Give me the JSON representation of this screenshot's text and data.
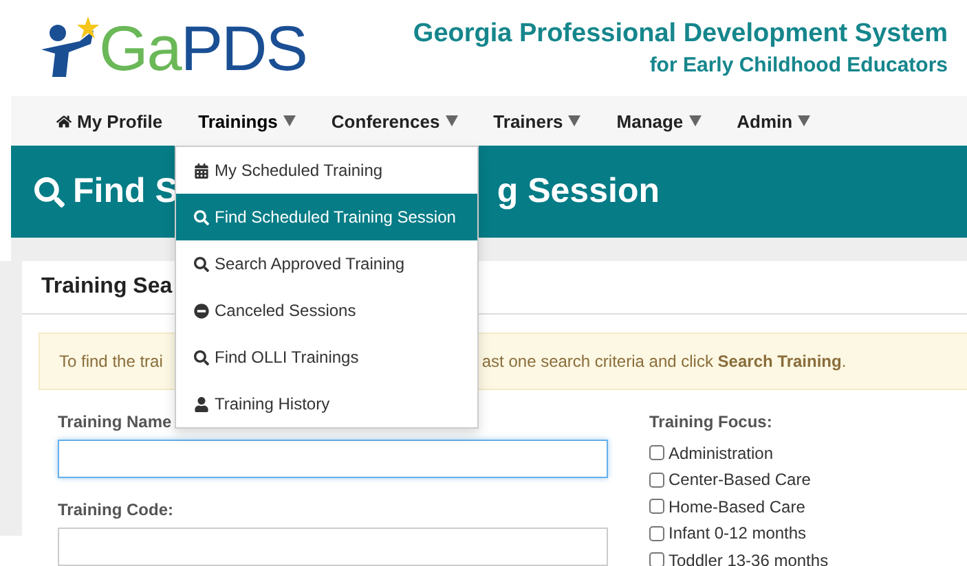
{
  "logo": {
    "text_green": "Ga",
    "text_blue": "PDS"
  },
  "header": {
    "title": "Georgia Professional Development System",
    "subtitle": "for Early Childhood Educators"
  },
  "nav": [
    {
      "label": "My Profile",
      "kind": "home",
      "expanded": false
    },
    {
      "label": "Trainings",
      "kind": "menu",
      "expanded": true
    },
    {
      "label": "Conferences",
      "kind": "menu",
      "expanded": false
    },
    {
      "label": "Trainers",
      "kind": "menu",
      "expanded": false
    },
    {
      "label": "Manage",
      "kind": "menu",
      "expanded": false
    },
    {
      "label": "Admin",
      "kind": "menu",
      "expanded": false
    }
  ],
  "dropdown": [
    {
      "label": "My Scheduled Training",
      "kind": "calendar",
      "selected": false
    },
    {
      "label": "Find Scheduled Training Session",
      "kind": "search",
      "selected": true
    },
    {
      "label": "Search Approved Training",
      "kind": "search",
      "selected": false
    },
    {
      "label": "Canceled Sessions",
      "kind": "minus",
      "selected": false
    },
    {
      "label": "Find OLLI Trainings",
      "kind": "search",
      "selected": false
    },
    {
      "label": "Training History",
      "kind": "user",
      "selected": false
    }
  ],
  "banner": {
    "title_start": "Find S",
    "title_end": "g Session"
  },
  "card": {
    "title": "Training Sea",
    "alert_start": "To find the trai",
    "alert_end": "ast one search criteria and click **Search Training**."
  },
  "fields": [
    {
      "label": "Training Name",
      "focused": true
    },
    {
      "label": "Training Code:",
      "focused": false
    }
  ],
  "focus": {
    "label": "Training Focus:",
    "options": [
      {
        "label": "Administration",
        "checked": false
      },
      {
        "label": "Center-Based Care",
        "checked": false
      },
      {
        "label": "Home-Based Care",
        "checked": false
      },
      {
        "label": "Infant 0-12 months",
        "checked": false
      },
      {
        "label": "Toddler 13-36 months",
        "checked": false
      }
    ]
  }
}
